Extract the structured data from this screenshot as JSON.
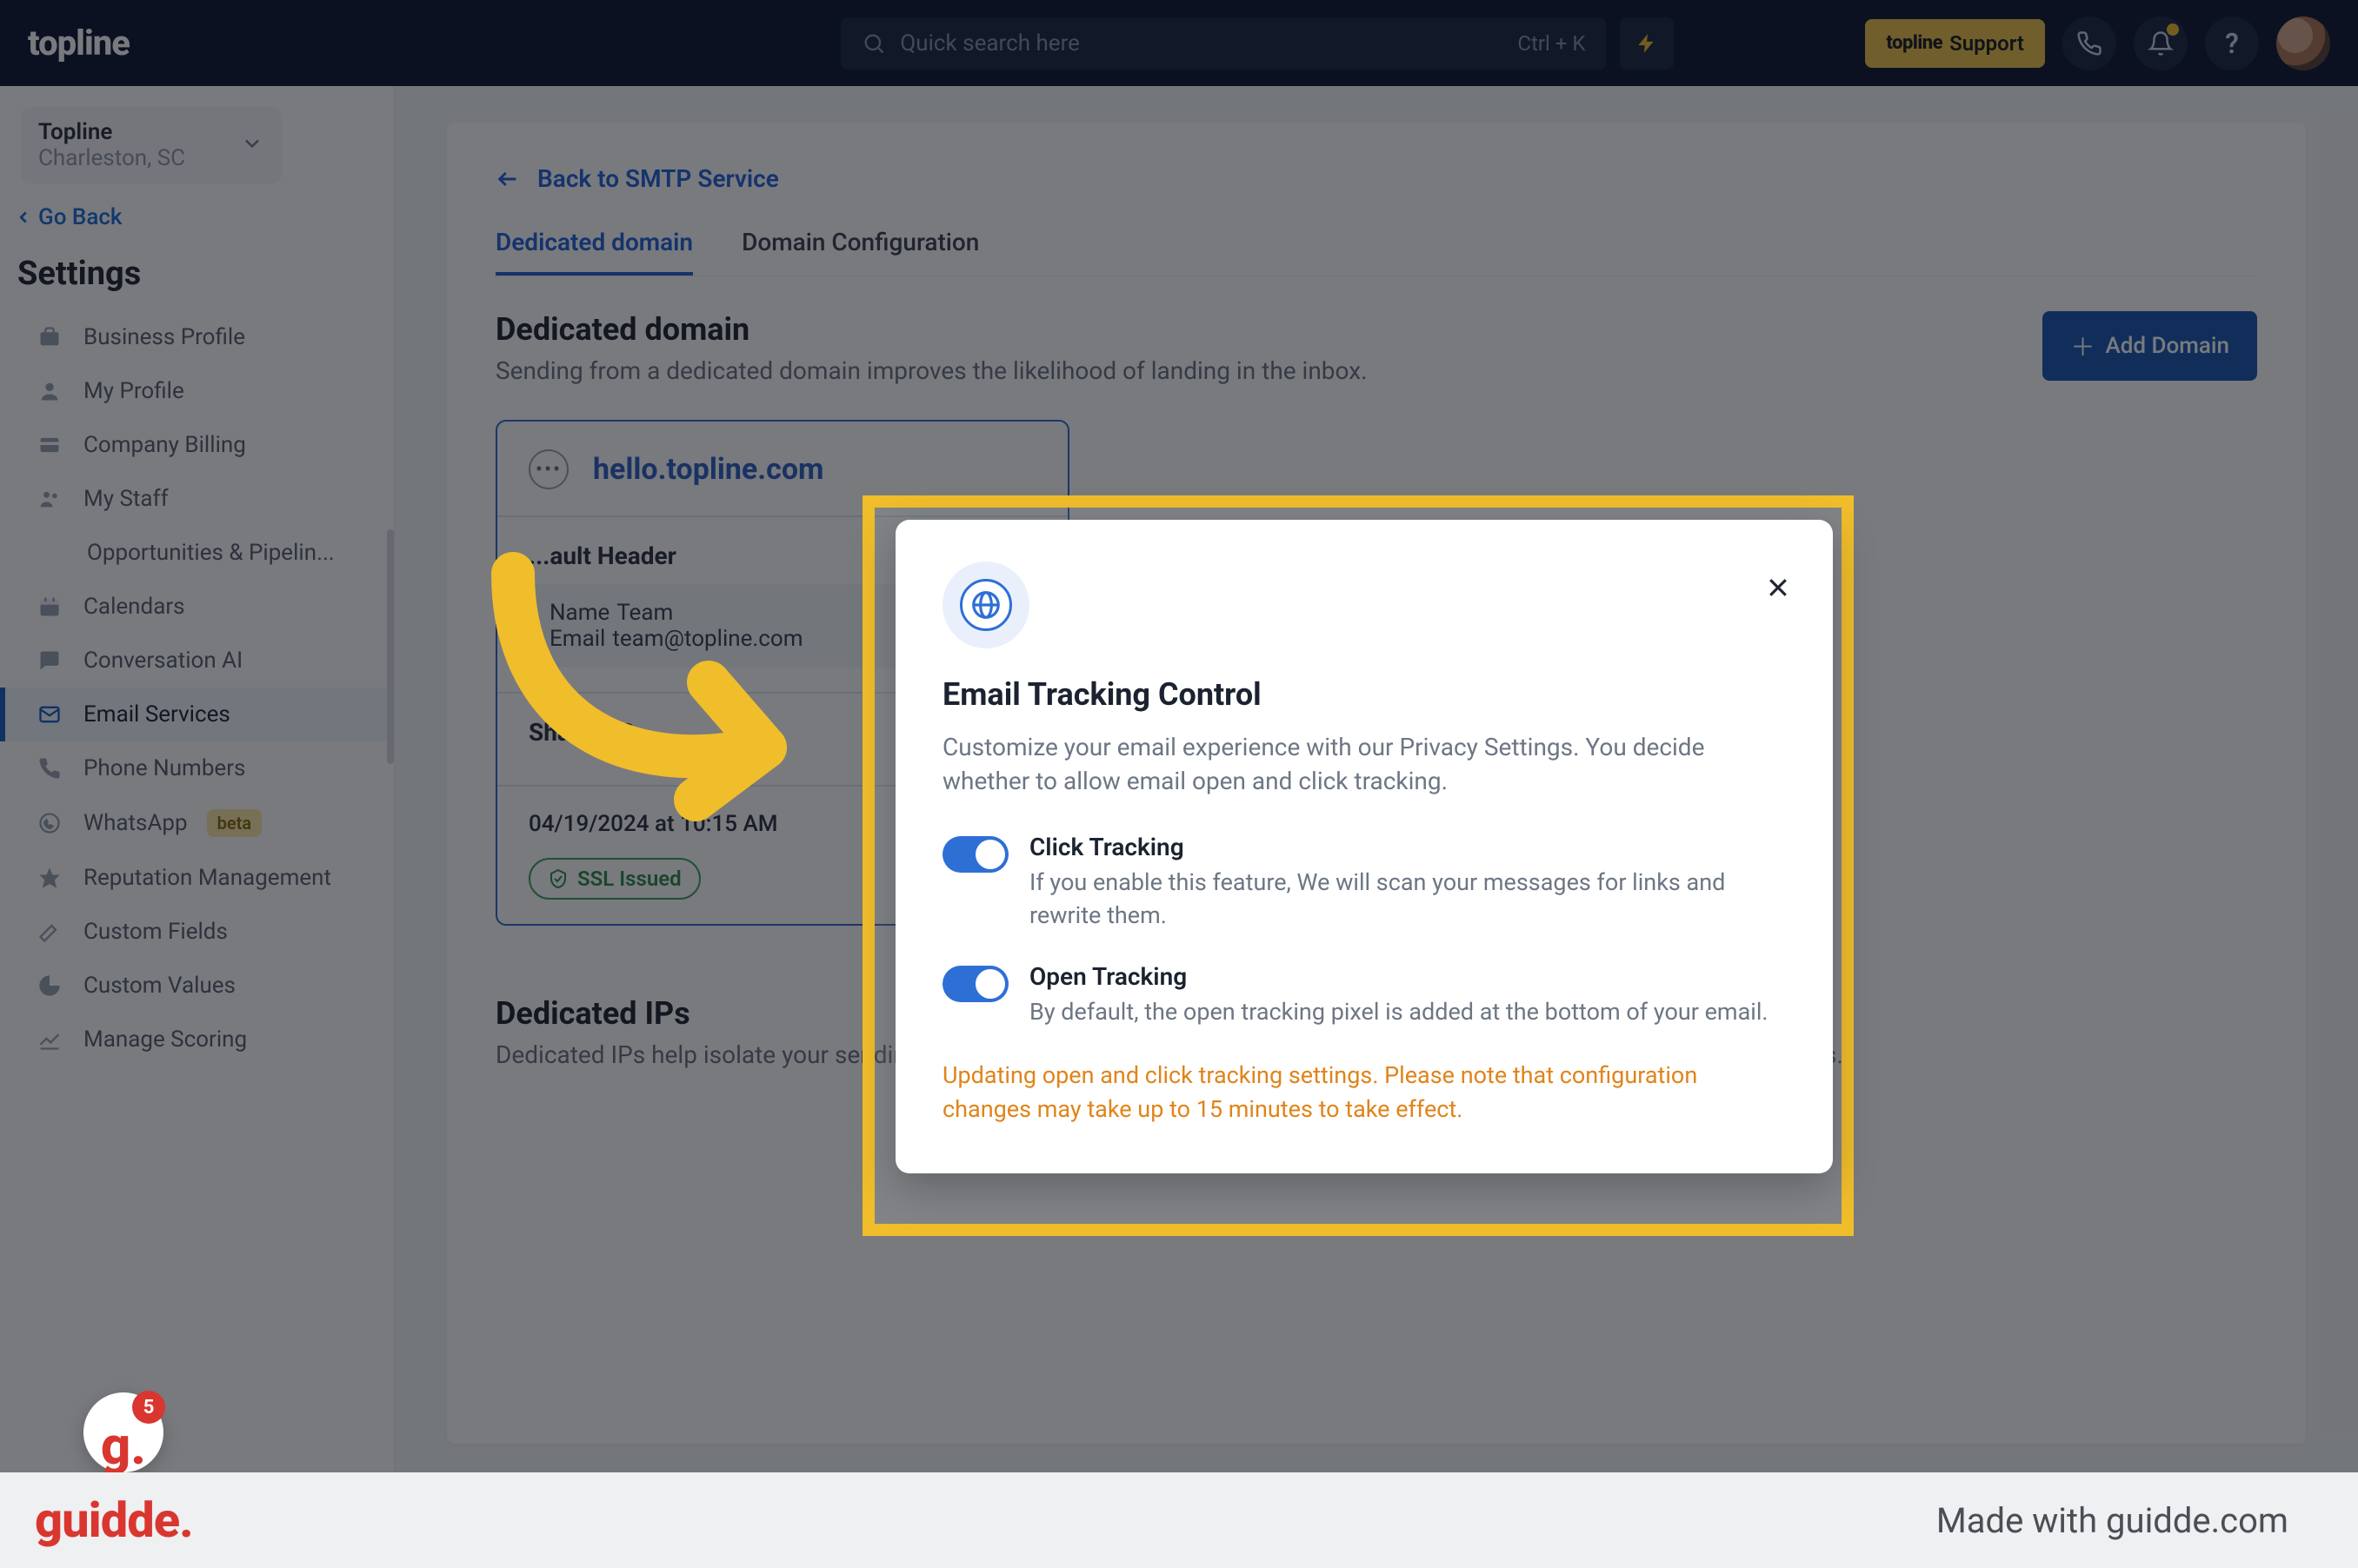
{
  "topbar": {
    "logo": "topline",
    "search_placeholder": "Quick search here",
    "search_kbd": "Ctrl + K",
    "support_brand": "topline",
    "support_label": "Support"
  },
  "sidebar": {
    "account_name": "Topline",
    "account_location": "Charleston, SC",
    "go_back": "Go Back",
    "settings_heading": "Settings",
    "items": [
      {
        "label": "Business Profile"
      },
      {
        "label": "My Profile"
      },
      {
        "label": "Company Billing"
      },
      {
        "label": "My Staff"
      },
      {
        "label": "Opportunities & Pipelin...",
        "sub": true
      },
      {
        "label": "Calendars"
      },
      {
        "label": "Conversation AI"
      },
      {
        "label": "Email Services",
        "active": true
      },
      {
        "label": "Phone Numbers"
      },
      {
        "label": "WhatsApp",
        "beta": "beta"
      },
      {
        "label": "Reputation Management"
      },
      {
        "label": "Custom Fields"
      },
      {
        "label": "Custom Values"
      },
      {
        "label": "Manage Scoring"
      }
    ]
  },
  "main": {
    "back_link": "Back to SMTP Service",
    "tabs": [
      {
        "label": "Dedicated domain",
        "active": true
      },
      {
        "label": "Domain Configuration"
      }
    ],
    "section1": {
      "title": "Dedicated domain",
      "subtitle": "Sending from a dedicated domain improves the likelihood of landing in the inbox.",
      "add_button": "Add Domain"
    },
    "domain_card": {
      "domain": "hello.topline.com",
      "header_block_title": "...ault Header",
      "name_label": "Name",
      "name_value": "Team",
      "email_label": "Email",
      "email_value": "team@topline.com",
      "shared_ip_title": "Shared IP",
      "timestamp": "04/19/2024 at 10:15 AM",
      "ssl": "SSL Issued"
    },
    "section2": {
      "title": "Dedicated IPs",
      "subtitle": "Dedicated IPs help isolate your sending reputation and improve your deliverability when sending a large volume of messages."
    }
  },
  "modal": {
    "title": "Email Tracking Control",
    "subtitle": "Customize your email experience with our Privacy Settings. You decide whether to allow email open and click tracking.",
    "opt1_title": "Click Tracking",
    "opt1_desc": "If you enable this feature, We will scan your messages for links and rewrite them.",
    "opt2_title": "Open Tracking",
    "opt2_desc": "By default, the open tracking pixel is added at the bottom of your email.",
    "warning": "Updating open and click tracking settings. Please note that configuration changes may take up to 15 minutes to take effect."
  },
  "guidde": {
    "logo": "guidde.",
    "made": "Made with guidde.com",
    "badge_count": "5"
  }
}
